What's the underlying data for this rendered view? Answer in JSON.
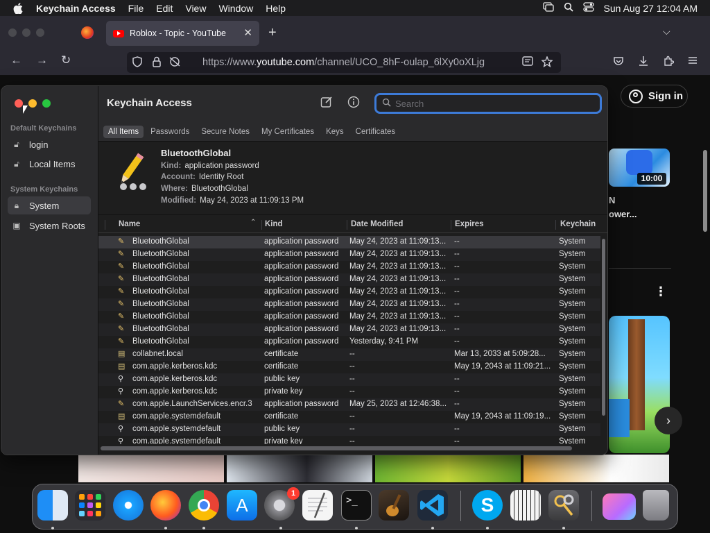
{
  "menubar": {
    "app_name": "Keychain Access",
    "items": [
      "File",
      "Edit",
      "View",
      "Window",
      "Help"
    ],
    "clock": "Sun Aug 27  12:04 AM"
  },
  "browser": {
    "tab_title": "Roblox - Topic - YouTube",
    "url_prefix": "https://www.",
    "url_domain": "youtube.com",
    "url_path": "/channel/UCO_8hF-oulap_6lXy0oXLjg"
  },
  "youtube": {
    "sign_in": "Sign in",
    "duration": "10:00",
    "video_title_line1": "N",
    "video_title_line2": "ower..."
  },
  "keychain": {
    "title": "Keychain Access",
    "search_placeholder": "Search",
    "sidebar": {
      "default_heading": "Default Keychains",
      "default_items": [
        "login",
        "Local Items"
      ],
      "system_heading": "System Keychains",
      "system_items": [
        "System",
        "System Roots"
      ]
    },
    "filters": [
      "All Items",
      "Passwords",
      "Secure Notes",
      "My Certificates",
      "Keys",
      "Certificates"
    ],
    "detail": {
      "name": "BluetoothGlobal",
      "kind_label": "Kind:",
      "kind": "application password",
      "account_label": "Account:",
      "account": "Identity Root",
      "where_label": "Where:",
      "where": "BluetoothGlobal",
      "modified_label": "Modified:",
      "modified": "May 24, 2023 at 11:09:13 PM"
    },
    "columns": [
      "Name",
      "Kind",
      "Date Modified",
      "Expires",
      "Keychain"
    ],
    "rows": [
      {
        "icon": "pencil",
        "name": "BluetoothGlobal",
        "kind": "application password",
        "date": "May 24, 2023 at 11:09:13...",
        "expires": "--",
        "keychain": "System"
      },
      {
        "icon": "pencil",
        "name": "BluetoothGlobal",
        "kind": "application password",
        "date": "May 24, 2023 at 11:09:13...",
        "expires": "--",
        "keychain": "System"
      },
      {
        "icon": "pencil",
        "name": "BluetoothGlobal",
        "kind": "application password",
        "date": "May 24, 2023 at 11:09:13...",
        "expires": "--",
        "keychain": "System"
      },
      {
        "icon": "pencil",
        "name": "BluetoothGlobal",
        "kind": "application password",
        "date": "May 24, 2023 at 11:09:13...",
        "expires": "--",
        "keychain": "System"
      },
      {
        "icon": "pencil",
        "name": "BluetoothGlobal",
        "kind": "application password",
        "date": "May 24, 2023 at 11:09:13...",
        "expires": "--",
        "keychain": "System"
      },
      {
        "icon": "pencil",
        "name": "BluetoothGlobal",
        "kind": "application password",
        "date": "May 24, 2023 at 11:09:13...",
        "expires": "--",
        "keychain": "System"
      },
      {
        "icon": "pencil",
        "name": "BluetoothGlobal",
        "kind": "application password",
        "date": "May 24, 2023 at 11:09:13...",
        "expires": "--",
        "keychain": "System"
      },
      {
        "icon": "pencil",
        "name": "BluetoothGlobal",
        "kind": "application password",
        "date": "May 24, 2023 at 11:09:13...",
        "expires": "--",
        "keychain": "System"
      },
      {
        "icon": "pencil",
        "name": "BluetoothGlobal",
        "kind": "application password",
        "date": "Yesterday, 9:41 PM",
        "expires": "--",
        "keychain": "System"
      },
      {
        "icon": "certificate",
        "name": "collabnet.local",
        "kind": "certificate",
        "date": "--",
        "expires": "Mar 13, 2033 at 5:09:28...",
        "keychain": "System"
      },
      {
        "icon": "certificate",
        "name": "com.apple.kerberos.kdc",
        "kind": "certificate",
        "date": "--",
        "expires": "May 19, 2043 at 11:09:21...",
        "keychain": "System"
      },
      {
        "icon": "key",
        "name": "com.apple.kerberos.kdc",
        "kind": "public key",
        "date": "--",
        "expires": "--",
        "keychain": "System"
      },
      {
        "icon": "key",
        "name": "com.apple.kerberos.kdc",
        "kind": "private key",
        "date": "--",
        "expires": "--",
        "keychain": "System"
      },
      {
        "icon": "pencil",
        "name": "com.apple.LaunchServices.encr.3",
        "kind": "application password",
        "date": "May 25, 2023 at 12:46:38...",
        "expires": "--",
        "keychain": "System"
      },
      {
        "icon": "certificate",
        "name": "com.apple.systemdefault",
        "kind": "certificate",
        "date": "--",
        "expires": "May 19, 2043 at 11:09:19...",
        "keychain": "System"
      },
      {
        "icon": "key",
        "name": "com.apple.systemdefault",
        "kind": "public key",
        "date": "--",
        "expires": "--",
        "keychain": "System"
      },
      {
        "icon": "key",
        "name": "com.apple.systemdefault",
        "kind": "private key",
        "date": "--",
        "expires": "--",
        "keychain": "System"
      }
    ]
  },
  "dock": {
    "badge": "1"
  }
}
